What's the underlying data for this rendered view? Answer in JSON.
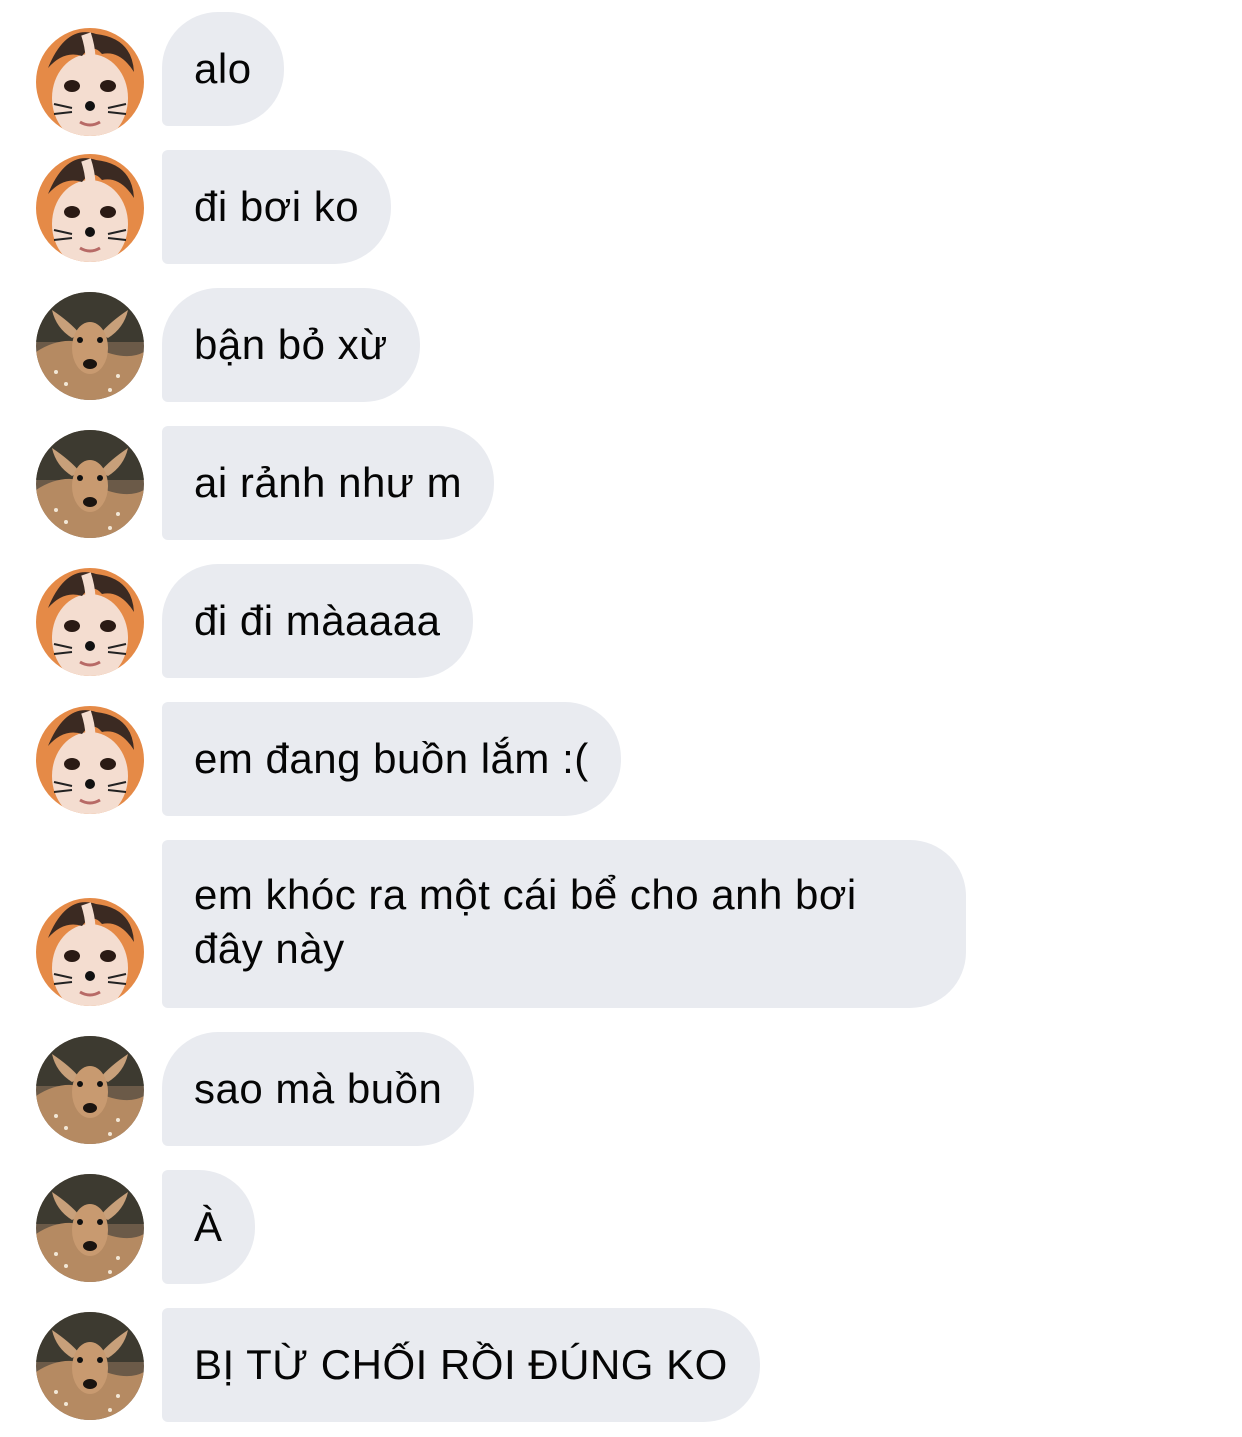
{
  "conversation": {
    "messages": [
      {
        "sender": "boy",
        "text": "alo"
      },
      {
        "sender": "boy",
        "text": "đi bơi ko"
      },
      {
        "sender": "deer",
        "text": "bận bỏ xừ"
      },
      {
        "sender": "deer",
        "text": "ai rảnh như m"
      },
      {
        "sender": "boy",
        "text": "đi đi màaaaa"
      },
      {
        "sender": "boy",
        "text": "em đang buồn lắm :("
      },
      {
        "sender": "boy",
        "text": "em khóc ra một cái bể cho anh bơi đây này"
      },
      {
        "sender": "deer",
        "text": "sao mà buồn"
      },
      {
        "sender": "deer",
        "text": "À"
      },
      {
        "sender": "deer",
        "text": "BỊ TỪ CHỐI RỒI ĐÚNG KO"
      }
    ]
  },
  "avatars": {
    "boy": {
      "icon": "boy-face-with-cat-whiskers-avatar",
      "bg_color": "#e58a47"
    },
    "deer": {
      "icon": "fawn-deer-avatar",
      "bg_color": "#6b5a48"
    }
  },
  "colors": {
    "bubble_bg": "#e9ebf0",
    "text": "#050505",
    "page_bg": "#ffffff"
  }
}
